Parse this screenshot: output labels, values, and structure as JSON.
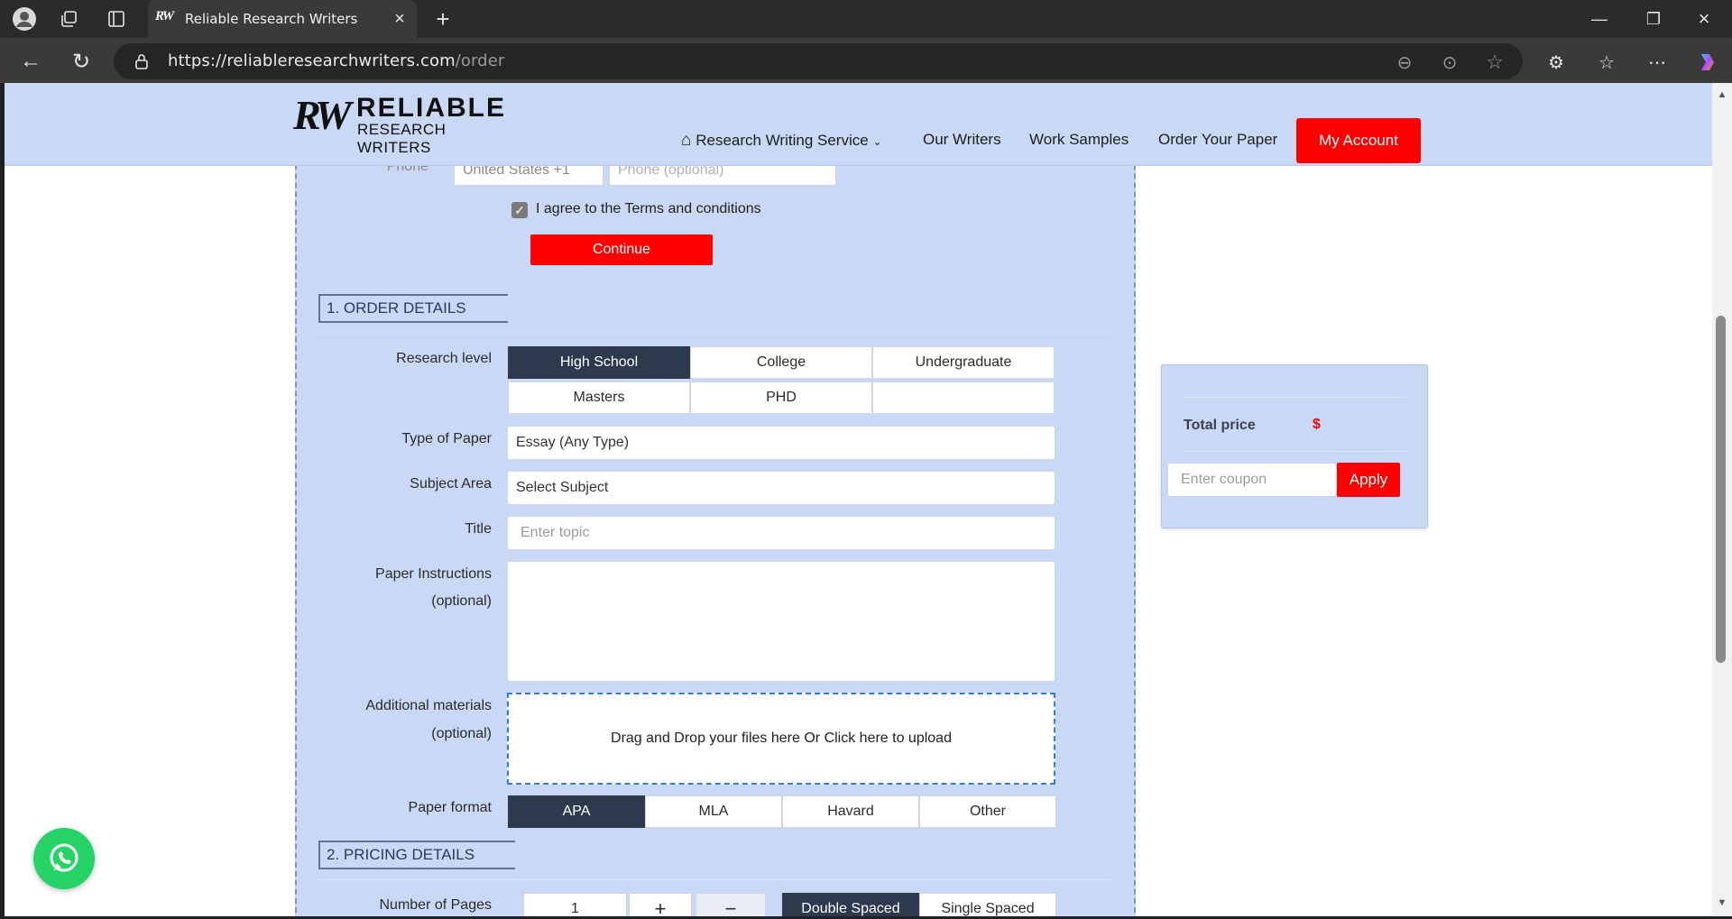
{
  "browser": {
    "tab_title": "Reliable Research Writers",
    "tab_favicon": "RW",
    "url_host": "https://reliableresearchwriters.com",
    "url_path": "/order"
  },
  "header": {
    "logo_mark": "RW",
    "logo_line1": "RELIABLE",
    "logo_line2": "RESEARCH WRITERS",
    "nav": {
      "service": "Research Writing Service",
      "writers": "Our Writers",
      "samples": "Work Samples",
      "order": "Order Your Paper",
      "account": "My Account"
    }
  },
  "contact": {
    "phone_label": "Phone",
    "country_code": "United States +1",
    "phone_placeholder": "Phone (optional)",
    "terms_label": "I agree to the Terms and conditions",
    "terms_checked": true,
    "continue_label": "Continue"
  },
  "order_details": {
    "section_title": "1. ORDER DETAILS",
    "research_level_label": "Research level",
    "levels": [
      "High School",
      "College",
      "Undergraduate",
      "Masters",
      "PHD"
    ],
    "selected_level": "High School",
    "paper_type_label": "Type of Paper",
    "paper_type_value": "Essay (Any Type)",
    "subject_label": "Subject Area",
    "subject_value": "Select Subject",
    "title_label": "Title",
    "title_placeholder": "Enter topic",
    "instructions_label": "Paper Instructions",
    "instructions_optional": "(optional)",
    "materials_label": "Additional materials",
    "materials_optional": "(optional)",
    "dropzone_text": "Drag and Drop your files here Or Click here to upload",
    "format_label": "Paper format",
    "formats": [
      "APA",
      "MLA",
      "Havard",
      "Other"
    ],
    "selected_format": "APA"
  },
  "pricing_details": {
    "section_title": "2. PRICING DETAILS",
    "pages_label": "Number of Pages",
    "pages_value": "1",
    "plus": "+",
    "minus": "−",
    "spacing_options": [
      "Double Spaced",
      "Single Spaced"
    ],
    "selected_spacing": "Double Spaced"
  },
  "summary": {
    "total_label": "Total price",
    "total_value": "$",
    "coupon_placeholder": "Enter coupon",
    "apply_label": "Apply"
  },
  "colors": {
    "brand_red": "#ff0000",
    "panel_blue": "#c9d8f5",
    "active_dark": "#2d3a4e",
    "whatsapp_green": "#25d366"
  }
}
